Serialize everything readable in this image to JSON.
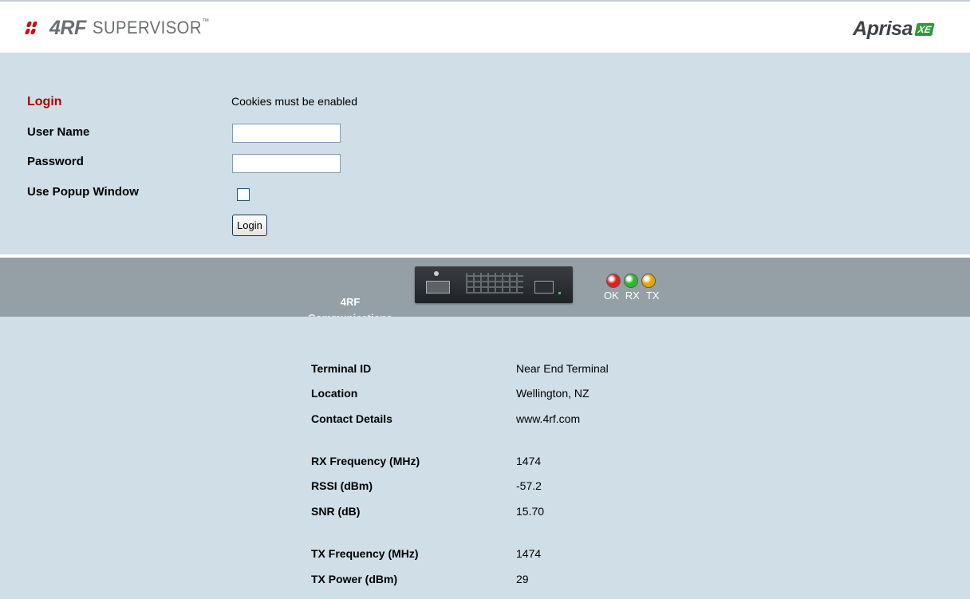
{
  "header": {
    "brand_name": "4RF",
    "brand_product": "SUPERVISOR",
    "brand_tm": "™",
    "product_name": "Aprisa",
    "product_badge": "XE"
  },
  "login": {
    "title": "Login",
    "cookie_notice": "Cookies must be enabled",
    "username_label": "User Name",
    "username_value": "",
    "password_label": "Password",
    "password_value": "",
    "popup_label": "Use Popup Window",
    "popup_checked": false,
    "button_label": "Login"
  },
  "device": {
    "company_line1": "4RF",
    "company_line2": "Communications",
    "leds": [
      {
        "label": "OK",
        "color": "#e02020"
      },
      {
        "label": "RX",
        "color": "#2fb82f"
      },
      {
        "label": "TX",
        "color": "#e6a800"
      }
    ]
  },
  "terminal": {
    "rows": [
      {
        "key": "Terminal ID",
        "value": "Near End Terminal"
      },
      {
        "key": "Location",
        "value": "Wellington, NZ"
      },
      {
        "key": "Contact Details",
        "value": "www.4rf.com"
      },
      {
        "key": "RX Frequency (MHz)",
        "value": "1474"
      },
      {
        "key": "RSSI (dBm)",
        "value": "-57.2"
      },
      {
        "key": "SNR (dB)",
        "value": "15.70"
      },
      {
        "key": "TX Frequency (MHz)",
        "value": "1474"
      },
      {
        "key": "TX Power (dBm)",
        "value": "29"
      }
    ]
  }
}
